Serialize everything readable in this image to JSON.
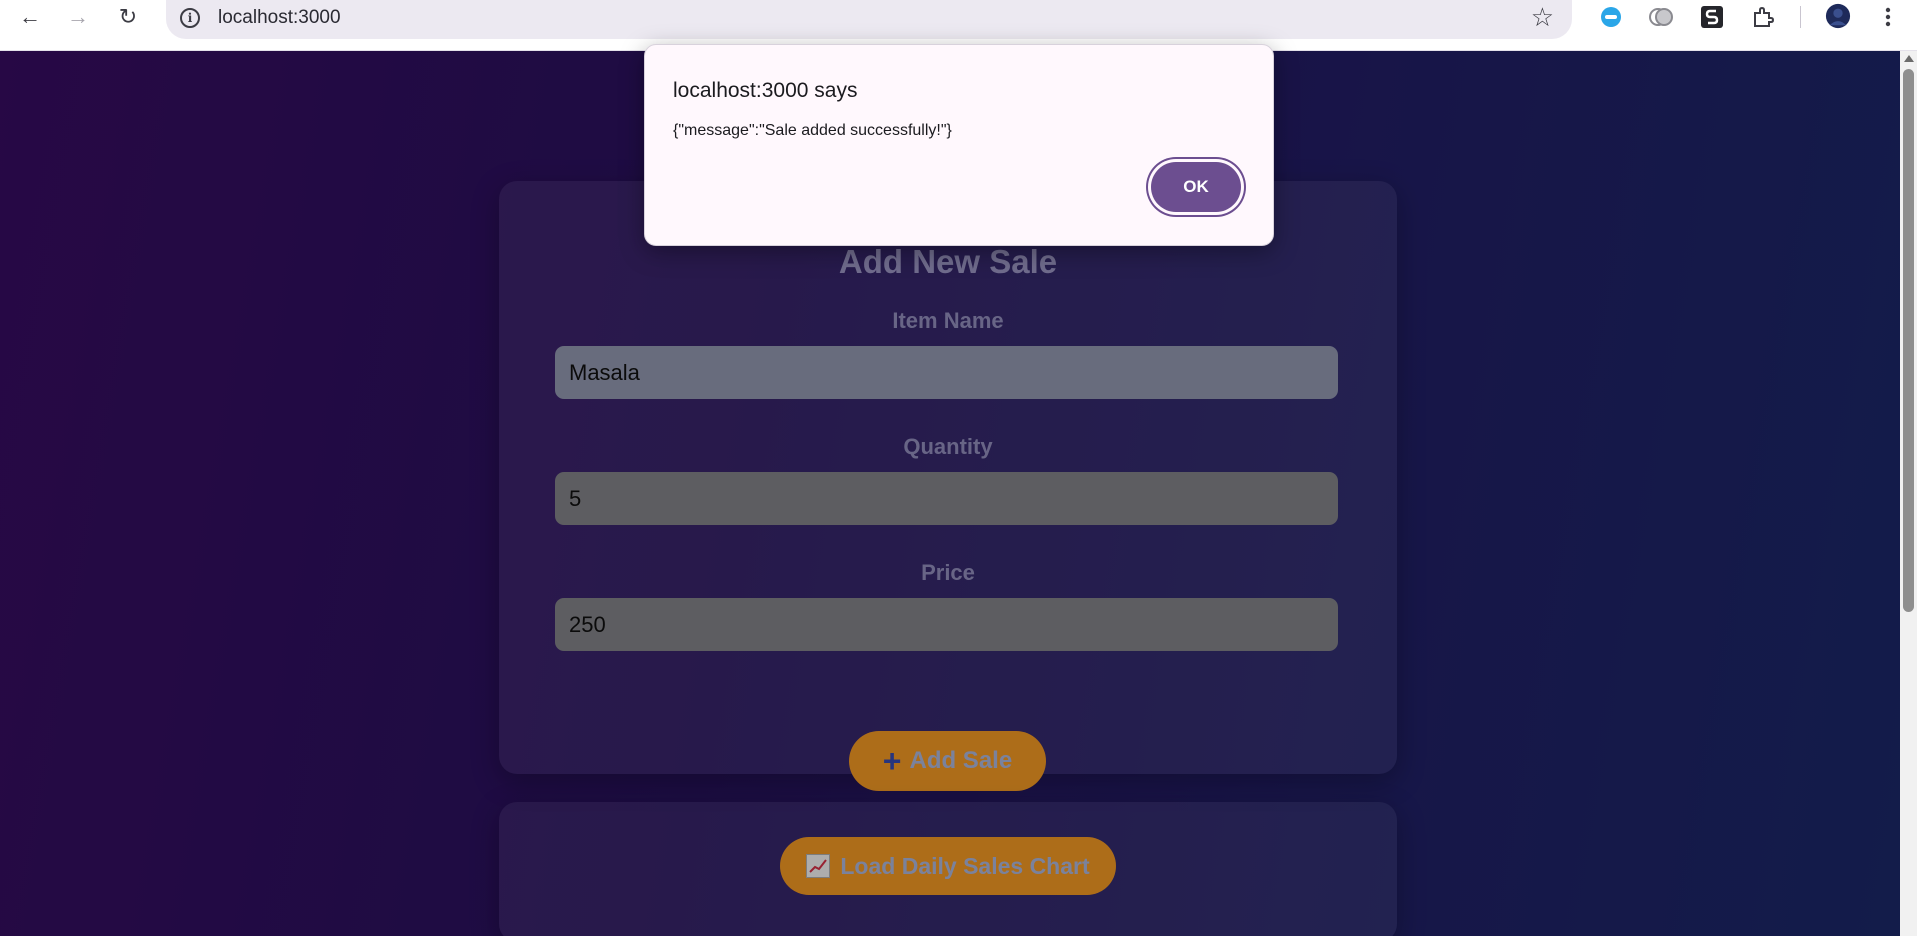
{
  "browser": {
    "url": "localhost:3000",
    "back_icon": "arrow-left-icon",
    "forward_icon": "arrow-right-icon",
    "reload_icon": "reload-icon",
    "bookmark_icon": "star-icon",
    "extensions": [
      "ai-chat-extension-icon",
      "gemini-extension-icon",
      "script-extension-icon",
      "puzzle-extensions-icon"
    ],
    "menu_icon": "more-vertical-icon"
  },
  "form": {
    "title": "Add New Sale",
    "item_name_label": "Item Name",
    "item_name_value": "Masala",
    "quantity_label": "Quantity",
    "quantity_value": "5",
    "price_label": "Price",
    "price_value": "250",
    "add_button_label": "Add Sale",
    "add_button_icon": "plus-icon"
  },
  "chart_section": {
    "load_button_label": "Load Daily Sales Chart",
    "load_button_icon": "chart-increasing-icon"
  },
  "dialog": {
    "title": "localhost:3000 says",
    "message": "{\"message\":\"Sale added successfully!\"}",
    "ok_label": "OK"
  },
  "colors": {
    "accent_orange": "#ffa126",
    "dialog_button": "#6c4e90",
    "page_gradient_start": "#3a0d66",
    "page_gradient_end": "#1c2a6d"
  }
}
